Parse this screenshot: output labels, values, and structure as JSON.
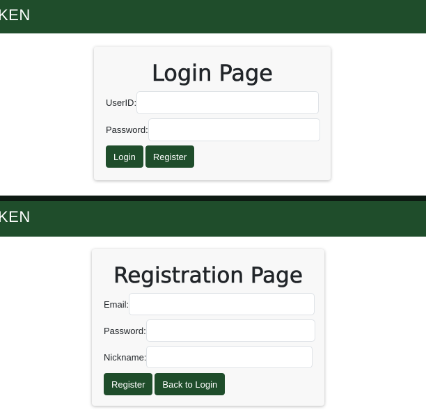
{
  "login_view": {
    "brand": "KEN",
    "title": "Login Page",
    "userid_label": "UserID:",
    "userid_value": "",
    "password_label": "Password:",
    "password_value": "",
    "login_button": "Login",
    "register_button": "Register"
  },
  "register_view": {
    "brand": "KEN",
    "title": "Registration Page",
    "email_label": "Email:",
    "email_value": "",
    "password_label": "Password:",
    "password_value": "",
    "nickname_label": "Nickname:",
    "nickname_value": "",
    "register_button": "Register",
    "back_button": "Back to Login"
  },
  "colors": {
    "brand_green": "#1f4d2b",
    "card_bg": "#f8f8f8"
  }
}
